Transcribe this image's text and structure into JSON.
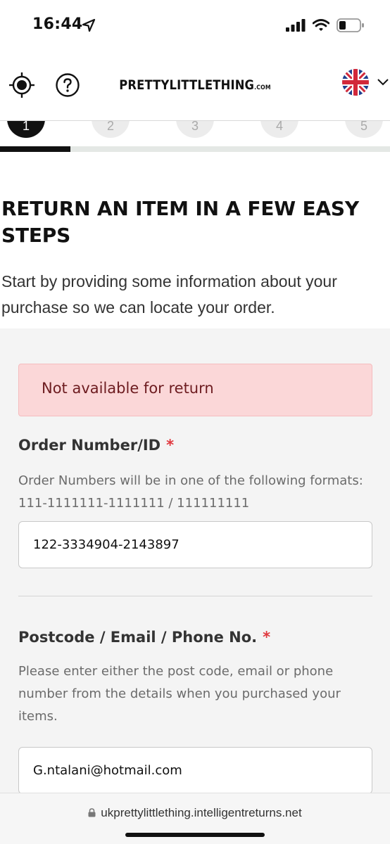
{
  "status_bar": {
    "time": "16:44",
    "icons": [
      "location-arrow-icon",
      "cellular-signal-icon",
      "wifi-icon",
      "battery-icon"
    ]
  },
  "header": {
    "brand": "PRETTYLITTLETHING",
    "brand_suffix": ".COM",
    "left_icons": [
      "locate-icon",
      "help-icon"
    ],
    "language_flag": "uk-flag-icon"
  },
  "stepper": {
    "steps": [
      "1",
      "2",
      "3",
      "4",
      "5"
    ],
    "active_step": 1,
    "progress_fraction": 0.18
  },
  "intro": {
    "title": "RETURN AN ITEM IN A FEW EASY STEPS",
    "description": "Start by providing some information about your purchase so we can locate your order."
  },
  "form": {
    "alert": "Not available for return",
    "order_field": {
      "label": "Order Number/ID",
      "required_mark": "*",
      "help": "Order Numbers will be in one of the following formats: 111-1111111-1111111 / 111111111",
      "value": "122-3334904-2143897"
    },
    "contact_field": {
      "label": "Postcode / Email / Phone No.",
      "required_mark": "*",
      "help": "Please enter either the post code, email or phone number from the details when you purchased your items.",
      "value": "G.ntalani@hotmail.com"
    }
  },
  "browser": {
    "url": "ukprettylittlething.intelligentreturns.net"
  },
  "colors": {
    "accent": "#111111",
    "alert_bg": "#fbd7d8",
    "alert_text": "#6d1c20",
    "required": "#e0383e",
    "form_bg": "#f4f4f4"
  }
}
